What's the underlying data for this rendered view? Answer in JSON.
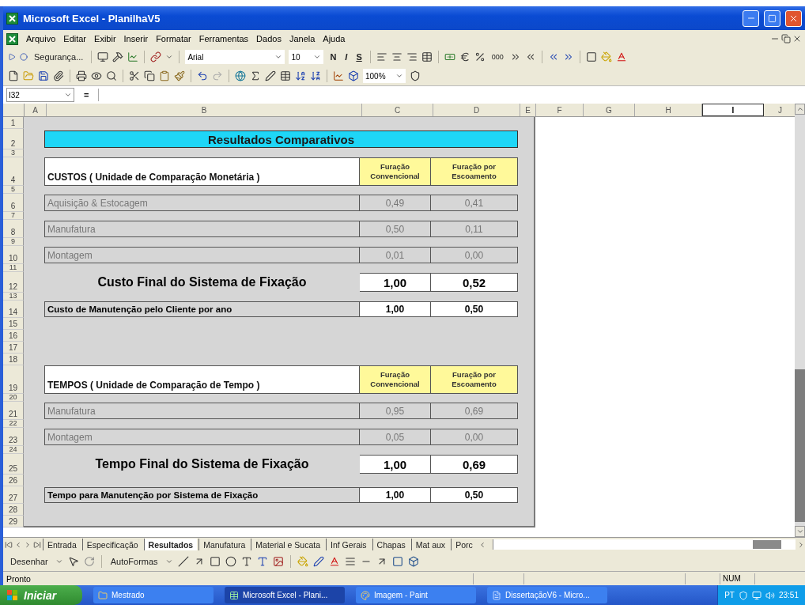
{
  "window": {
    "title": "Microsoft Excel - PlanilhaV5"
  },
  "menu": [
    "Arquivo",
    "Editar",
    "Exibir",
    "Inserir",
    "Formatar",
    "Ferramentas",
    "Dados",
    "Janela",
    "Ajuda"
  ],
  "toolbar": {
    "security": "Segurança...",
    "font": "Arial",
    "font_size": "10",
    "style_buttons": [
      "N",
      "I",
      "S"
    ],
    "thousands": "000",
    "zoom": "100%"
  },
  "formula_bar": {
    "name_box": "I32",
    "formula_button": "="
  },
  "columns": [
    {
      "label": "A",
      "selected": false
    },
    {
      "label": "B",
      "selected": false
    },
    {
      "label": "C",
      "selected": false
    },
    {
      "label": "D",
      "selected": false
    },
    {
      "label": "E",
      "selected": false
    },
    {
      "label": "F",
      "selected": false
    },
    {
      "label": "G",
      "selected": false
    },
    {
      "label": "H",
      "selected": false
    },
    {
      "label": "I",
      "selected": true
    },
    {
      "label": "J",
      "selected": false
    }
  ],
  "rows": [
    {
      "number": "1",
      "kind": "blank"
    },
    {
      "number": "2",
      "kind": "title",
      "text": "Resultados Comparativos"
    },
    {
      "number": "3",
      "kind": "spacer"
    },
    {
      "number": "4",
      "kind": "header",
      "label": "CUSTOS ( Unidade de Comparação Monetária )",
      "values": [
        "Furação Convencional",
        "Furação por Escoamento"
      ]
    },
    {
      "number": "5",
      "kind": "spacer"
    },
    {
      "number": "6",
      "kind": "item",
      "label": "Aquisição & Estocagem",
      "values": [
        "0,49",
        "0,41"
      ]
    },
    {
      "number": "7",
      "kind": "spacer"
    },
    {
      "number": "8",
      "kind": "item",
      "label": "Manufatura",
      "values": [
        "0,50",
        "0,11"
      ]
    },
    {
      "number": "9",
      "kind": "spacer"
    },
    {
      "number": "10",
      "kind": "item",
      "label": "Montagem",
      "values": [
        "0,01",
        "0,00"
      ]
    },
    {
      "number": "11",
      "kind": "spacer"
    },
    {
      "number": "12",
      "kind": "total",
      "label": "Custo Final do Sistema de Fixação",
      "values": [
        "1,00",
        "0,52"
      ]
    },
    {
      "number": "13",
      "kind": "spacer"
    },
    {
      "number": "14",
      "kind": "maint",
      "label": "Custo de Manutenção pelo Cliente por ano",
      "values": [
        "1,00",
        "0,50"
      ]
    },
    {
      "number": "15",
      "kind": "blank"
    },
    {
      "number": "16",
      "kind": "blank"
    },
    {
      "number": "17",
      "kind": "blank"
    },
    {
      "number": "18",
      "kind": "blank"
    },
    {
      "number": "19",
      "kind": "header",
      "label": "TEMPOS ( Unidade de Comparação de Tempo )",
      "values": [
        "Furação Convencional",
        "Furação por Escoamento"
      ]
    },
    {
      "number": "20",
      "kind": "spacer"
    },
    {
      "number": "21",
      "kind": "item",
      "label": "Manufatura",
      "values": [
        "0,95",
        "0,69"
      ]
    },
    {
      "number": "22",
      "kind": "spacer"
    },
    {
      "number": "23",
      "kind": "item",
      "label": "Montagem",
      "values": [
        "0,05",
        "0,00"
      ]
    },
    {
      "number": "24",
      "kind": "spacer"
    },
    {
      "number": "25",
      "kind": "total",
      "label": "Tempo Final do Sistema de Fixação",
      "values": [
        "1,00",
        "0,69"
      ]
    },
    {
      "number": "26",
      "kind": "blank"
    },
    {
      "number": "27",
      "kind": "maint",
      "label": "Tempo para Manutenção por Sistema de Fixação",
      "values": [
        "1,00",
        "0,50"
      ]
    },
    {
      "number": "28",
      "kind": "blank"
    },
    {
      "number": "29",
      "kind": "blank"
    }
  ],
  "sheet_tabs": [
    {
      "label": "Entrada",
      "selected": false
    },
    {
      "label": "Especificação",
      "selected": false
    },
    {
      "label": "Resultados",
      "selected": true
    },
    {
      "label": "Manufatura",
      "selected": false
    },
    {
      "label": "Material e Sucata",
      "selected": false
    },
    {
      "label": "Inf Gerais",
      "selected": false
    },
    {
      "label": "Chapas",
      "selected": false
    },
    {
      "label": "Mat aux",
      "selected": false
    },
    {
      "label": "Porc",
      "selected": false
    }
  ],
  "drawing_toolbar": {
    "draw": "Desenhar",
    "autoshapes": "AutoFormas"
  },
  "status_bar": {
    "text": "Pronto",
    "indicator": "NUM"
  },
  "taskbar": {
    "start": "Iniciar",
    "tasks": [
      {
        "label": "Mestrado",
        "selected": false
      },
      {
        "label": "Microsoft Excel - Plani...",
        "selected": true
      },
      {
        "label": "Imagem - Paint",
        "selected": false
      },
      {
        "label": "DissertaçãoV6 - Micro...",
        "selected": false
      }
    ],
    "language": "PT",
    "clock": "23:51"
  }
}
